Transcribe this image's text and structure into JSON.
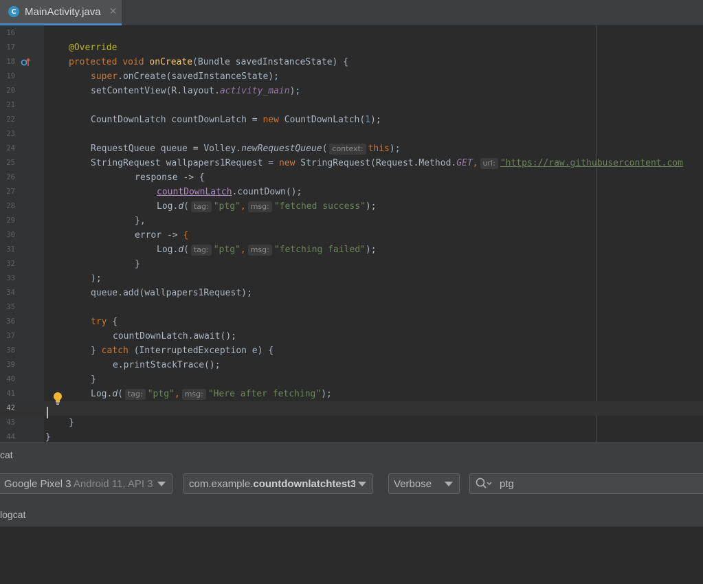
{
  "tab": {
    "icon": "C",
    "label": "MainActivity.java",
    "close": "✕"
  },
  "editor": {
    "line_numbers": [
      "16",
      "17",
      "18",
      "19",
      "20",
      "21",
      "22",
      "23",
      "24",
      "25",
      "26",
      "27",
      "28",
      "29",
      "30",
      "31",
      "32",
      "33",
      "34",
      "35",
      "36",
      "37",
      "38",
      "39",
      "40",
      "41",
      "42",
      "43",
      "44"
    ],
    "current_line": "42",
    "code_text": {
      "l17": [
        "@Override"
      ],
      "l18": [
        "protected",
        "void",
        "onCreate",
        "(Bundle savedInstanceState) {"
      ],
      "l19": [
        "super",
        ".onCreate(savedInstanceState);"
      ],
      "l20": [
        "setContentView(R.layout.",
        "activity_main",
        ");"
      ],
      "l22": [
        "CountDownLatch countDownLatch = ",
        "new",
        " CountDownLatch(",
        "1",
        ");"
      ],
      "l24": [
        "RequestQueue queue = Volley.",
        "newRequestQueue",
        "(",
        "context:",
        "this",
        ");"
      ],
      "l25": [
        "StringRequest wallpapers1Request = ",
        "new",
        " StringRequest(Request.Method.",
        "GET",
        ",",
        "url:",
        "\"https://raw.githubusercontent.com"
      ],
      "l26": [
        "response -> {"
      ],
      "l27": [
        "countDownLatch",
        ".countDown();"
      ],
      "l28": [
        "Log.",
        "d",
        "(",
        "tag:",
        "\"ptg\"",
        ",",
        "msg:",
        "\"fetched success\"",
        ");"
      ],
      "l29": [
        "},"
      ],
      "l30": [
        "error -> ",
        "{"
      ],
      "l31": [
        "Log.",
        "d",
        "(",
        "tag:",
        "\"ptg\"",
        ",",
        "msg:",
        "\"fetching failed\"",
        ");"
      ],
      "l32": [
        "}"
      ],
      "l33": [
        ");"
      ],
      "l34": [
        "queue.add(wallpapers1Request);"
      ],
      "l36": [
        "try",
        " {"
      ],
      "l37": [
        "countDownLatch.await();"
      ],
      "l38": [
        "} ",
        "catch",
        " (InterruptedException e) {"
      ],
      "l39": [
        "e.printStackTrace();"
      ],
      "l40": [
        "}"
      ],
      "l41": [
        "Log.",
        "d",
        "(",
        "tag:",
        "\"ptg\"",
        ",",
        "msg:",
        "\"Here after fetching\"",
        ");"
      ],
      "l43": [
        "}"
      ],
      "l44": [
        "}"
      ]
    }
  },
  "panel": {
    "title": "cat",
    "sublabel": "logcat"
  },
  "toolbar": {
    "device": {
      "name": "Google Pixel 3",
      "detail": " Android 11, API 3"
    },
    "process": {
      "prefix": "com.example.",
      "name": "countdownlatchtest3"
    },
    "level": "Verbose",
    "search_value": "ptg"
  },
  "colors": {
    "background": "#2b2b2b",
    "keyword": "#cc7832",
    "string": "#6a8759",
    "method": "#ffc66d",
    "accent": "#4a88c7"
  },
  "icons": [
    "java-class-icon",
    "override-gutter-icon",
    "lightbulb-icon",
    "dropdown-arrow-icon",
    "search-icon"
  ]
}
